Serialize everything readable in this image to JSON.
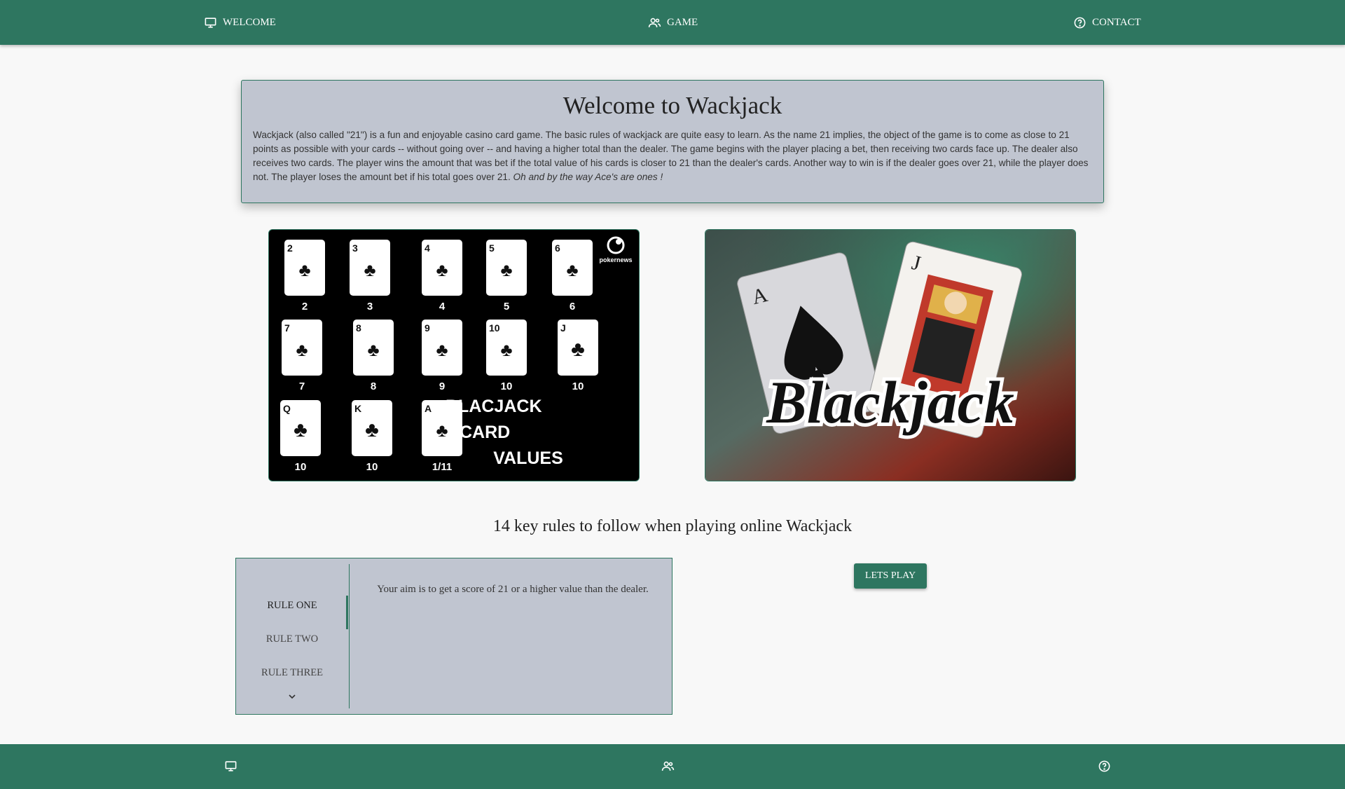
{
  "nav": {
    "items": [
      {
        "label": "WELCOME",
        "icon": "monitor-icon"
      },
      {
        "label": "GAME",
        "icon": "users-icon"
      },
      {
        "label": "CONTACT",
        "icon": "help-circle-icon"
      }
    ]
  },
  "welcome": {
    "title": "Welcome to Wackjack",
    "body": "Wackjack (also called \"21\") is a fun and enjoyable casino card game. The basic rules of wackjack are quite easy to learn. As the name 21 implies, the object of the game is to come as close to 21 points as possible with your cards -- without going over -- and having a higher total than the dealer. The game begins with the player placing a bet, then receiving two cards face up. The dealer also receives two cards. The player wins the amount that was bet if the total value of his cards is closer to 21 than the dealer's cards. Another way to win is if the dealer goes over 21, while the player does not. The player loses the amount bet if his total goes over 21.",
    "italic": "Oh and by the way Ace's are ones !"
  },
  "card_values_image": {
    "brand": "pokernews",
    "title_lines": [
      "BLACJACK",
      "CARD",
      "VALUES"
    ],
    "cards": [
      {
        "rank": "2",
        "value": "2"
      },
      {
        "rank": "3",
        "value": "3"
      },
      {
        "rank": "4",
        "value": "4"
      },
      {
        "rank": "5",
        "value": "5"
      },
      {
        "rank": "6",
        "value": "6"
      },
      {
        "rank": "7",
        "value": "7"
      },
      {
        "rank": "8",
        "value": "8"
      },
      {
        "rank": "9",
        "value": "9"
      },
      {
        "rank": "10",
        "value": "10"
      },
      {
        "rank": "J",
        "value": "10"
      },
      {
        "rank": "Q",
        "value": "10"
      },
      {
        "rank": "K",
        "value": "10"
      },
      {
        "rank": "A",
        "value": "1/11"
      }
    ]
  },
  "blackjack_image": {
    "logo_text": "Blackjack"
  },
  "rules": {
    "heading": "14 key rules to follow when playing online Wackjack",
    "tabs": [
      "RULE ONE",
      "RULE TWO",
      "RULE THREE"
    ],
    "active_tab": 0,
    "content": "Your aim is to get a score of 21 or a higher value than the dealer."
  },
  "play_button": {
    "label": "LETS PLAY"
  },
  "footer": {
    "icons": [
      "monitor-icon",
      "users-icon",
      "help-circle-icon"
    ]
  },
  "colors": {
    "primary": "#2e7660",
    "card_bg": "#c0c5d0",
    "page_bg": "#f8f8f8"
  }
}
